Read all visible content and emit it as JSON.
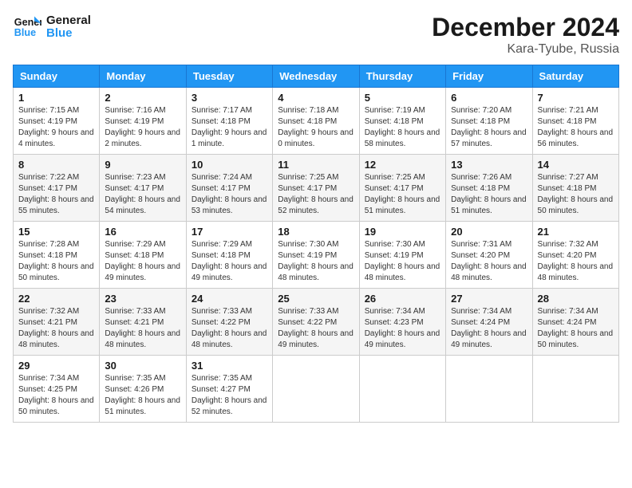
{
  "logo": {
    "text_general": "General",
    "text_blue": "Blue"
  },
  "title": {
    "month_year": "December 2024",
    "location": "Kara-Tyube, Russia"
  },
  "weekdays": [
    "Sunday",
    "Monday",
    "Tuesday",
    "Wednesday",
    "Thursday",
    "Friday",
    "Saturday"
  ],
  "weeks": [
    [
      {
        "day": "1",
        "sunrise": "7:15 AM",
        "sunset": "4:19 PM",
        "daylight": "9 hours and 4 minutes."
      },
      {
        "day": "2",
        "sunrise": "7:16 AM",
        "sunset": "4:19 PM",
        "daylight": "9 hours and 2 minutes."
      },
      {
        "day": "3",
        "sunrise": "7:17 AM",
        "sunset": "4:18 PM",
        "daylight": "9 hours and 1 minute."
      },
      {
        "day": "4",
        "sunrise": "7:18 AM",
        "sunset": "4:18 PM",
        "daylight": "9 hours and 0 minutes."
      },
      {
        "day": "5",
        "sunrise": "7:19 AM",
        "sunset": "4:18 PM",
        "daylight": "8 hours and 58 minutes."
      },
      {
        "day": "6",
        "sunrise": "7:20 AM",
        "sunset": "4:18 PM",
        "daylight": "8 hours and 57 minutes."
      },
      {
        "day": "7",
        "sunrise": "7:21 AM",
        "sunset": "4:18 PM",
        "daylight": "8 hours and 56 minutes."
      }
    ],
    [
      {
        "day": "8",
        "sunrise": "7:22 AM",
        "sunset": "4:17 PM",
        "daylight": "8 hours and 55 minutes."
      },
      {
        "day": "9",
        "sunrise": "7:23 AM",
        "sunset": "4:17 PM",
        "daylight": "8 hours and 54 minutes."
      },
      {
        "day": "10",
        "sunrise": "7:24 AM",
        "sunset": "4:17 PM",
        "daylight": "8 hours and 53 minutes."
      },
      {
        "day": "11",
        "sunrise": "7:25 AM",
        "sunset": "4:17 PM",
        "daylight": "8 hours and 52 minutes."
      },
      {
        "day": "12",
        "sunrise": "7:25 AM",
        "sunset": "4:17 PM",
        "daylight": "8 hours and 51 minutes."
      },
      {
        "day": "13",
        "sunrise": "7:26 AM",
        "sunset": "4:18 PM",
        "daylight": "8 hours and 51 minutes."
      },
      {
        "day": "14",
        "sunrise": "7:27 AM",
        "sunset": "4:18 PM",
        "daylight": "8 hours and 50 minutes."
      }
    ],
    [
      {
        "day": "15",
        "sunrise": "7:28 AM",
        "sunset": "4:18 PM",
        "daylight": "8 hours and 50 minutes."
      },
      {
        "day": "16",
        "sunrise": "7:29 AM",
        "sunset": "4:18 PM",
        "daylight": "8 hours and 49 minutes."
      },
      {
        "day": "17",
        "sunrise": "7:29 AM",
        "sunset": "4:18 PM",
        "daylight": "8 hours and 49 minutes."
      },
      {
        "day": "18",
        "sunrise": "7:30 AM",
        "sunset": "4:19 PM",
        "daylight": "8 hours and 48 minutes."
      },
      {
        "day": "19",
        "sunrise": "7:30 AM",
        "sunset": "4:19 PM",
        "daylight": "8 hours and 48 minutes."
      },
      {
        "day": "20",
        "sunrise": "7:31 AM",
        "sunset": "4:20 PM",
        "daylight": "8 hours and 48 minutes."
      },
      {
        "day": "21",
        "sunrise": "7:32 AM",
        "sunset": "4:20 PM",
        "daylight": "8 hours and 48 minutes."
      }
    ],
    [
      {
        "day": "22",
        "sunrise": "7:32 AM",
        "sunset": "4:21 PM",
        "daylight": "8 hours and 48 minutes."
      },
      {
        "day": "23",
        "sunrise": "7:33 AM",
        "sunset": "4:21 PM",
        "daylight": "8 hours and 48 minutes."
      },
      {
        "day": "24",
        "sunrise": "7:33 AM",
        "sunset": "4:22 PM",
        "daylight": "8 hours and 48 minutes."
      },
      {
        "day": "25",
        "sunrise": "7:33 AM",
        "sunset": "4:22 PM",
        "daylight": "8 hours and 49 minutes."
      },
      {
        "day": "26",
        "sunrise": "7:34 AM",
        "sunset": "4:23 PM",
        "daylight": "8 hours and 49 minutes."
      },
      {
        "day": "27",
        "sunrise": "7:34 AM",
        "sunset": "4:24 PM",
        "daylight": "8 hours and 49 minutes."
      },
      {
        "day": "28",
        "sunrise": "7:34 AM",
        "sunset": "4:24 PM",
        "daylight": "8 hours and 50 minutes."
      }
    ],
    [
      {
        "day": "29",
        "sunrise": "7:34 AM",
        "sunset": "4:25 PM",
        "daylight": "8 hours and 50 minutes."
      },
      {
        "day": "30",
        "sunrise": "7:35 AM",
        "sunset": "4:26 PM",
        "daylight": "8 hours and 51 minutes."
      },
      {
        "day": "31",
        "sunrise": "7:35 AM",
        "sunset": "4:27 PM",
        "daylight": "8 hours and 52 minutes."
      },
      null,
      null,
      null,
      null
    ]
  ],
  "labels": {
    "sunrise": "Sunrise:",
    "sunset": "Sunset:",
    "daylight": "Daylight:"
  }
}
